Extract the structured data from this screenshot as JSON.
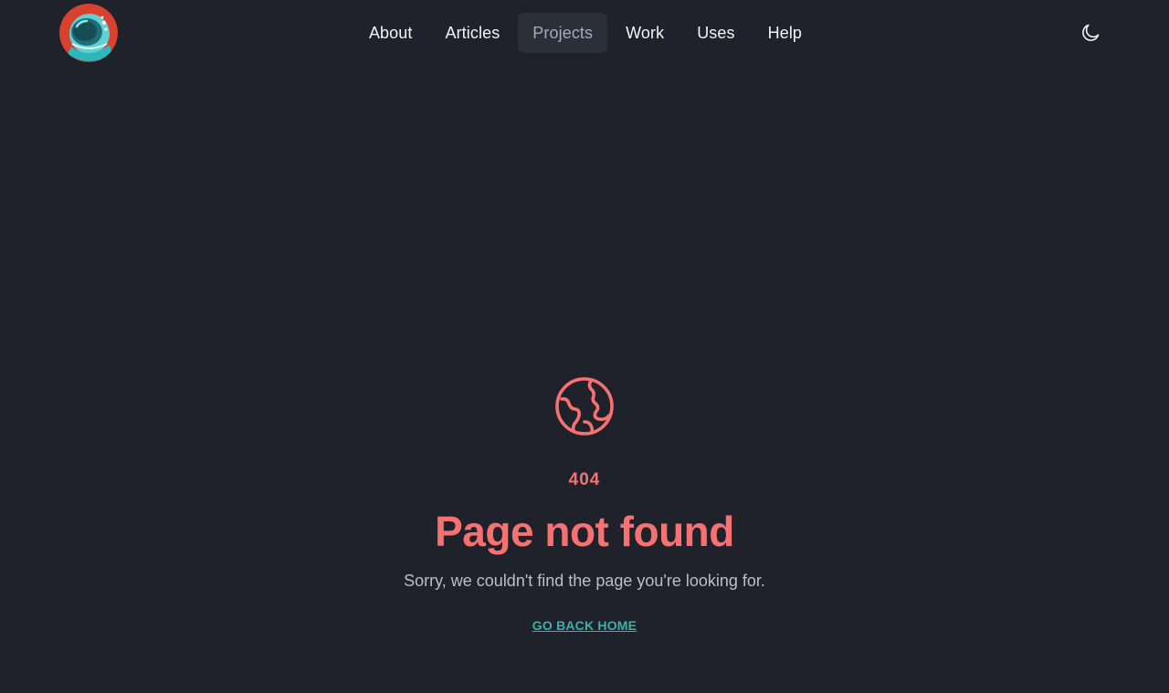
{
  "header": {
    "logo_alt": "astronaut helmet logo",
    "nav": {
      "items": [
        {
          "label": "About",
          "active": false
        },
        {
          "label": "Articles",
          "active": false
        },
        {
          "label": "Projects",
          "active": true
        },
        {
          "label": "Work",
          "active": false
        },
        {
          "label": "Uses",
          "active": false
        },
        {
          "label": "Help",
          "active": false
        }
      ]
    },
    "theme_toggle_icon": "moon-icon"
  },
  "main": {
    "icon": "globe-icon",
    "code": "404",
    "title": "Page not found",
    "message": "Sorry, we couldn't find the page you're looking for.",
    "home_link": "GO BACK HOME"
  },
  "colors": {
    "background": "#1f222a",
    "accent": "#f87171",
    "link": "#38b2ac",
    "nav_active_bg": "#2b2f3a",
    "text_muted": "#b9bfcb"
  }
}
